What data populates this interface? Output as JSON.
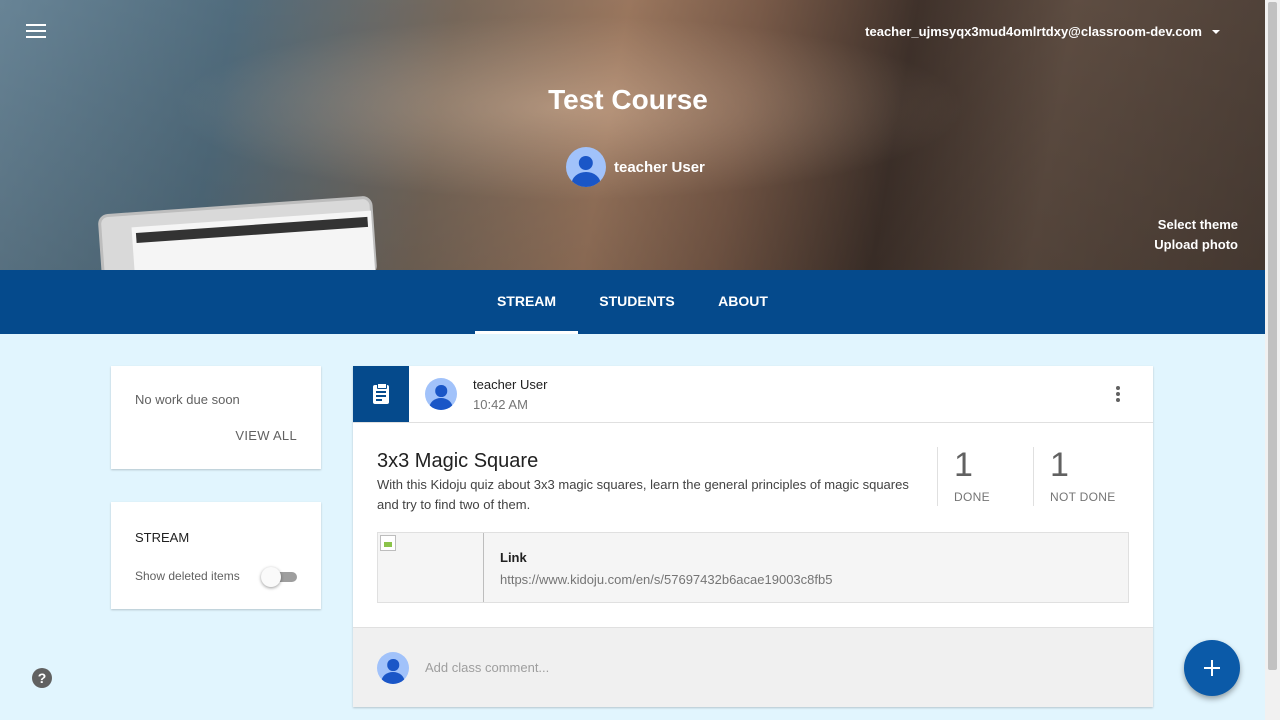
{
  "header": {
    "account_email": "teacher_ujmsyqx3mud4omlrtdxy@classroom-dev.com",
    "course_title": "Test Course",
    "teacher_name": "teacher User",
    "select_theme": "Select theme",
    "upload_photo": "Upload photo"
  },
  "tabs": [
    {
      "label": "STREAM",
      "active": true
    },
    {
      "label": "STUDENTS",
      "active": false
    },
    {
      "label": "ABOUT",
      "active": false
    }
  ],
  "sidebar": {
    "due": {
      "message": "No work due soon",
      "view_all": "VIEW ALL"
    },
    "stream": {
      "title": "STREAM",
      "show_deleted_label": "Show deleted items",
      "show_deleted_on": false
    }
  },
  "post": {
    "author": "teacher User",
    "time": "10:42 AM",
    "title": "3x3 Magic Square",
    "description": "With this Kidoju quiz about 3x3 magic squares, learn the general principles of magic squares and try to find two of them.",
    "stats": {
      "done_count": "1",
      "done_label": "DONE",
      "not_done_count": "1",
      "not_done_label": "NOT DONE"
    },
    "attachment": {
      "title": "Link",
      "url": "https://www.kidoju.com/en/s/57697432b6acae19003c8fb5"
    },
    "comment_placeholder": "Add class comment..."
  },
  "help_icon": "?",
  "colors": {
    "primary": "#054a8c",
    "background": "#e1f5fe",
    "fab": "#0b5aa8"
  },
  "icons": [
    "menu-icon",
    "caret-down-icon",
    "assignment-icon",
    "more-vert-icon",
    "help-icon",
    "add-icon",
    "avatar-icon"
  ]
}
